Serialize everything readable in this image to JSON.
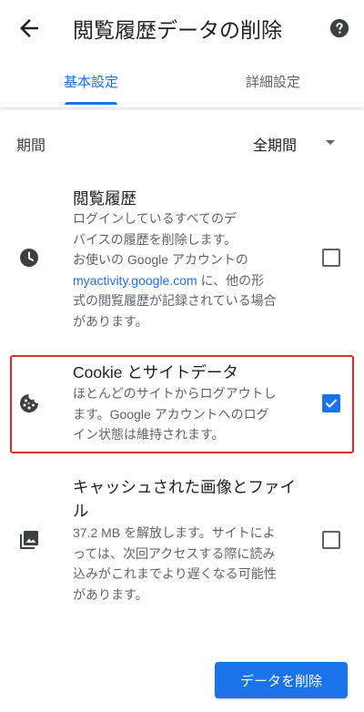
{
  "header": {
    "title": "閲覧履歴データの削除",
    "back_icon": "arrow-back-icon",
    "help_icon": "help-circle-icon"
  },
  "tabs": [
    {
      "label": "基本設定",
      "selected": true
    },
    {
      "label": "詳細設定",
      "selected": false
    }
  ],
  "time_range": {
    "label": "期間",
    "selected": "全期間"
  },
  "items": [
    {
      "title": "閲覧履歴",
      "desc_lines": [
        "ログインしているすべてのデ",
        "バイスの履歴を削除します。",
        "お使いの Google アカウントの"
      ],
      "desc_link": "myactivity.google.com",
      "desc_link_suffix": " に、他の形",
      "desc_lines_after": [
        "式の閲覧履歴が記録されている場合",
        "があります。"
      ],
      "icon": "clock-icon",
      "checked": false
    },
    {
      "title": "Cookie とサイトデータ",
      "desc_lines": [
        "ほとんどのサイトからログアウトし",
        "ます。Google アカウントへのログ",
        "イン状態は維持されます。"
      ],
      "icon": "cookie-icon",
      "checked": true
    },
    {
      "title_lines": [
        "キャッシュされた画像とファイ",
        "ル"
      ],
      "desc_lines": [
        "37.2 MB を解放します。サイトによ",
        "っては、次回アクセスする際に読み",
        "込みがこれまでより遅くなる可能性",
        "があります。"
      ],
      "icon": "photo-library-icon",
      "checked": false
    }
  ],
  "actions": {
    "delete_label": "データを削除"
  },
  "colors": {
    "accent": "#1a73e8",
    "highlight": "#d93025",
    "text_primary": "#202124",
    "text_secondary": "#5f6368"
  }
}
